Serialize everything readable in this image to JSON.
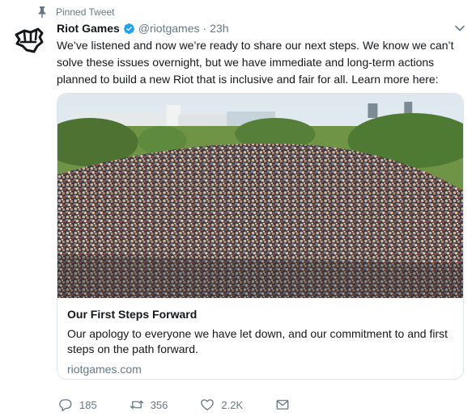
{
  "pinned": {
    "label": "Pinned Tweet",
    "icon": "pin-icon"
  },
  "author": {
    "name": "Riot Games",
    "handle": "@riotgames",
    "separator": "·",
    "time": "23h",
    "verified_icon": "verified-badge-icon",
    "avatar_icon": "riot-fist-logo"
  },
  "tweet": {
    "text": "We’ve listened and now we’re ready to share our next steps. We know we can’t solve these issues overnight, but we have immediate and long-term actions planned to build a new Riot that is inclusive and fair for all. Learn more here:"
  },
  "card": {
    "title": "Our First Steps Forward",
    "description": "Our apology to everyone we have let down, and our commitment to and first steps on the path forward.",
    "domain": "riotgames.com",
    "image": "crowd-group-photo"
  },
  "actions": {
    "reply": {
      "icon": "reply-icon",
      "count": "185"
    },
    "retweet": {
      "icon": "retweet-icon",
      "count": "356"
    },
    "like": {
      "icon": "heart-icon",
      "count": "2.2K"
    },
    "dm": {
      "icon": "envelope-icon"
    }
  },
  "colors": {
    "text": "#14171a",
    "secondary": "#657786",
    "verified": "#1da1f2",
    "border": "#e1e8ed"
  }
}
